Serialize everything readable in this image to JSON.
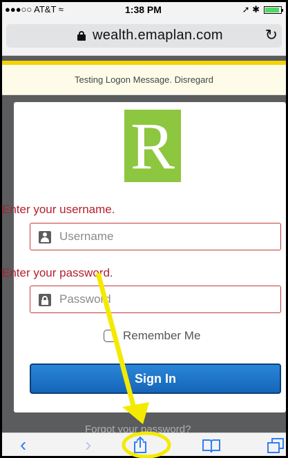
{
  "status_bar": {
    "carrier": "●●●○○ AT&T ≈",
    "time": "1:38 PM",
    "right_icons": "➚ ✱"
  },
  "url_bar": {
    "url": "wealth.emaplan.com",
    "reload_icon": "reload-icon"
  },
  "banner": {
    "message": "Testing Logon Message. Disregard"
  },
  "login": {
    "logo_letter": "R",
    "username_label": "Enter your username.",
    "username_placeholder": "Username",
    "password_label": "Enter your password.",
    "password_placeholder": "Password",
    "remember_label": "Remember Me",
    "sign_in_label": "Sign In",
    "forgot_link": "Forgot your password?"
  },
  "toolbar": {
    "icons": [
      "back-icon",
      "forward-icon",
      "share-icon",
      "bookmarks-icon",
      "tabs-icon"
    ]
  },
  "colors": {
    "logo_green": "#8dc63f",
    "error_red": "#b21f2d",
    "button_blue": "#1565b8",
    "annotation_yellow": "#f4ea00",
    "banner_accent": "#f5d200"
  }
}
